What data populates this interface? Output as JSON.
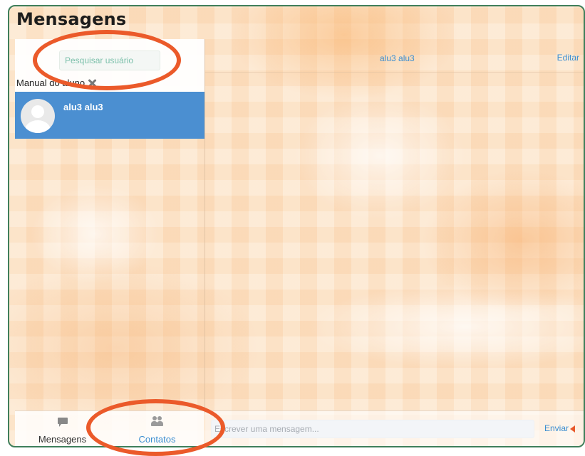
{
  "page": {
    "title": "Mensagens"
  },
  "search": {
    "placeholder": "Pesquisar usuário"
  },
  "manual": {
    "label": "Manual do aluno"
  },
  "contacts": [
    {
      "name": "alu3 alu3",
      "selected": true
    }
  ],
  "chat": {
    "contact_name": "alu3 alu3",
    "edit_label": "Editar",
    "message_placeholder": "Escrever uma mensagem...",
    "send_label": "Enviar"
  },
  "bottom_nav": {
    "tabs": [
      {
        "label": "Mensagens",
        "icon": "chat-icon",
        "active": false
      },
      {
        "label": "Contatos",
        "icon": "users-icon",
        "active": true
      }
    ]
  },
  "colors": {
    "accent_blue": "#3b8ed1",
    "selected_row": "#4b8fd1",
    "annotation_orange": "#eb5a2a",
    "frame_border": "#3f7f5b"
  }
}
